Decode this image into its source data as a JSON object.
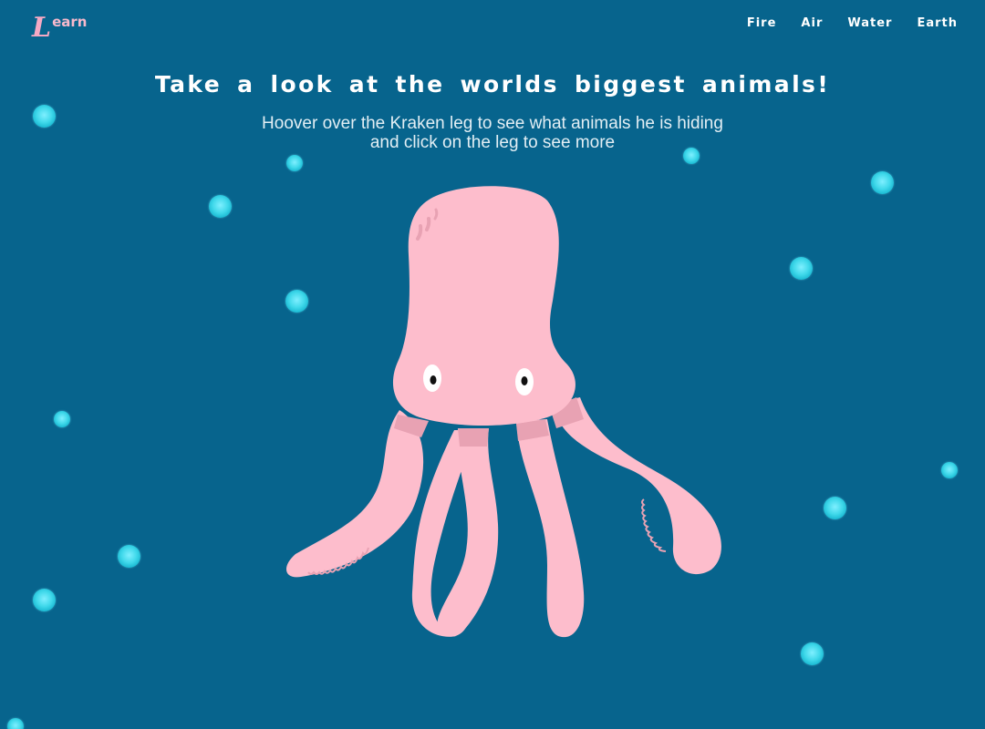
{
  "header": {
    "logo_initial": "L",
    "logo_rest": "earn",
    "nav": [
      {
        "label": "Fire"
      },
      {
        "label": "Air"
      },
      {
        "label": "Water"
      },
      {
        "label": "Earth"
      }
    ]
  },
  "hero": {
    "title": "Take a look at the worlds biggest animals!",
    "subtitle": "Hoover over the Kraken leg to see what animals he is hiding and click on the leg to see more"
  },
  "colors": {
    "background": "#07648d",
    "kraken_body": "#fdbdcc",
    "kraken_band": "#e8a2b3",
    "logo": "#f5a9c4",
    "bubble": "#3fd8ea"
  },
  "icons": {
    "kraken": "kraken-octopus-illustration",
    "bubble": "water-bubble-icon"
  }
}
